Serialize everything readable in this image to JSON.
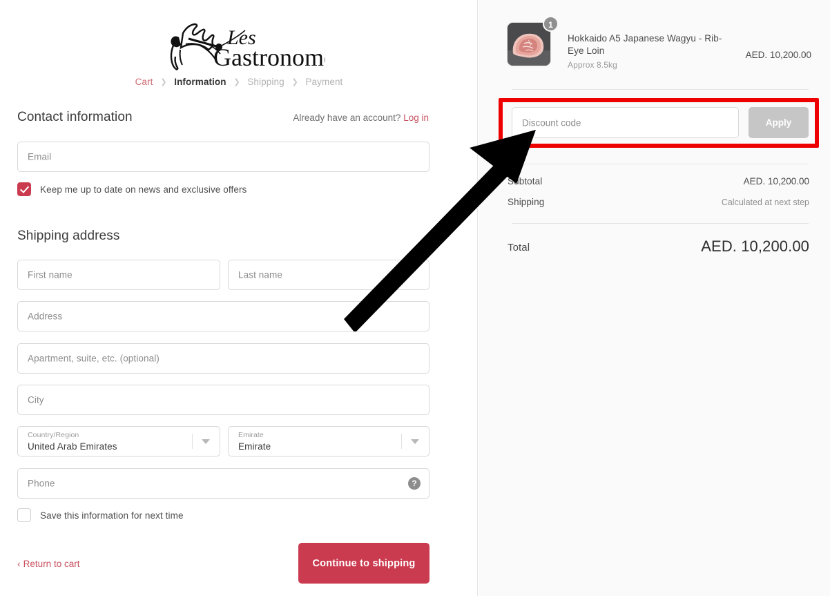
{
  "brand": {
    "logo_text": "Gastronomes",
    "logo_script": "Les",
    "logo_icon": "rooster-chef-illustration"
  },
  "breadcrumb": {
    "steps": [
      {
        "label": "Cart",
        "state": "link"
      },
      {
        "label": "Information",
        "state": "current"
      },
      {
        "label": "Shipping",
        "state": "upcoming"
      },
      {
        "label": "Payment",
        "state": "upcoming"
      }
    ],
    "separator": "❯"
  },
  "contact": {
    "heading": "Contact information",
    "account_prompt": "Already have an account?",
    "login_label": "Log in",
    "email_placeholder": "Email",
    "email_value": "",
    "newsletter_label": "Keep me up to date on news and exclusive offers",
    "newsletter_checked": true
  },
  "shipping_address": {
    "heading": "Shipping address",
    "first_name_placeholder": "First name",
    "first_name_value": "",
    "last_name_placeholder": "Last name",
    "last_name_value": "",
    "address_placeholder": "Address",
    "address_value": "",
    "apartment_placeholder": "Apartment, suite, etc. (optional)",
    "apartment_value": "",
    "city_placeholder": "City",
    "city_value": "",
    "country_label": "Country/Region",
    "country_value": "United Arab Emirates",
    "emirate_label": "Emirate",
    "emirate_value": "Emirate",
    "phone_placeholder": "Phone",
    "phone_value": "",
    "phone_help_glyph": "?",
    "save_info_label": "Save this information for next time",
    "save_info_checked": false
  },
  "footer": {
    "return_chevron": "‹",
    "return_label": "Return to cart",
    "continue_label": "Continue to shipping"
  },
  "order_summary": {
    "items": [
      {
        "title": "Hokkaido A5 Japanese Wagyu - Rib-Eye Loin",
        "variant": "Approx 8.5kg",
        "quantity": "1",
        "price": "AED. 10,200.00",
        "image_alt": "wagyu-beef-cut-photo"
      }
    ],
    "discount_placeholder": "Discount code",
    "discount_value": "",
    "apply_label": "Apply",
    "apply_disabled": true,
    "subtotal_label": "Subtotal",
    "subtotal_value": "AED. 10,200.00",
    "shipping_label": "Shipping",
    "shipping_value": "Calculated at next step",
    "total_label": "Total",
    "total_value": "AED. 10,200.00"
  },
  "annotations": {
    "highlight_color": "#ee0000",
    "arrow_color": "#000000",
    "target": "discount-code-field"
  },
  "colors": {
    "brand_red": "#cb3b4f",
    "link_red": "#c8505f",
    "summary_bg": "#fafafa",
    "field_border": "#d9d9d9",
    "disabled_button": "#c6c6c6"
  }
}
